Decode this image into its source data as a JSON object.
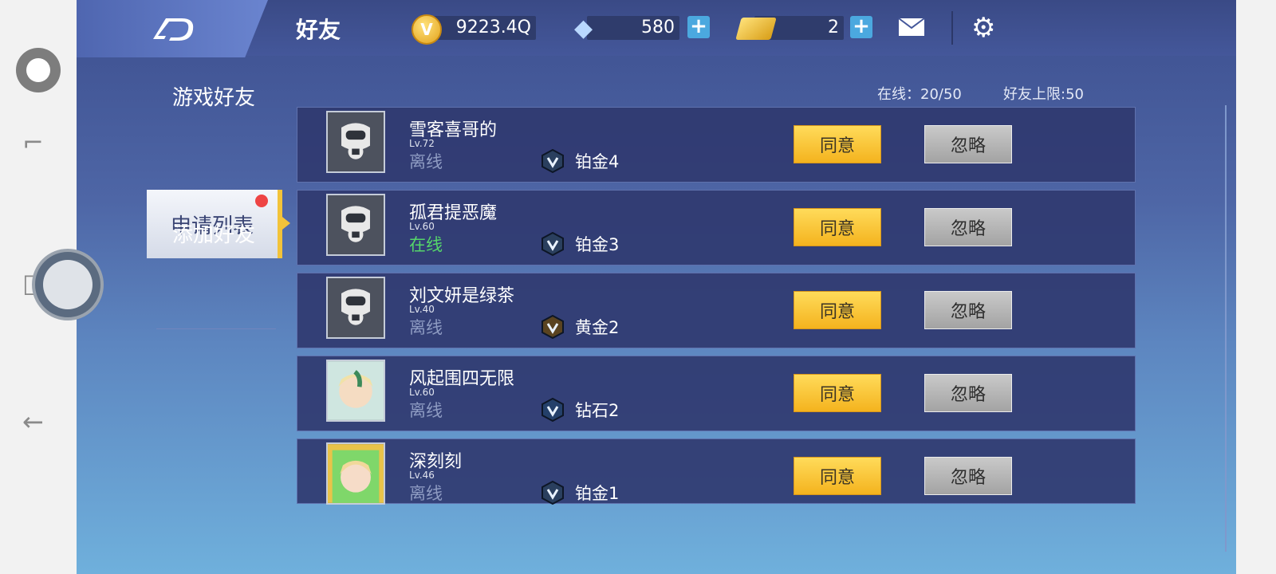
{
  "system": {
    "icons": [
      "circle-icon",
      "split-screen-icon",
      "recents-icon",
      "back-arrow-icon"
    ]
  },
  "header": {
    "title": "好友",
    "coins": "9223.4Q",
    "coin_glyph": "V",
    "diamonds": "580",
    "tickets": "2",
    "plus": "+"
  },
  "menu": {
    "items": [
      {
        "label": "游戏好友"
      },
      {
        "label": "申请列表"
      },
      {
        "label": "添加好友"
      }
    ]
  },
  "stats": {
    "online": "在线：20/50",
    "limit": "好友上限:50"
  },
  "requests": [
    {
      "name": "雪客喜哥的",
      "level": "Lv.72",
      "status": "离线",
      "rank": "铂金4",
      "agree": "同意",
      "ignore": "忽略"
    },
    {
      "name": "孤君提恶魔",
      "level": "Lv.60",
      "status": "在线",
      "rank": "铂金3",
      "agree": "同意",
      "ignore": "忽略"
    },
    {
      "name": "刘文妍是绿茶",
      "level": "Lv.40",
      "status": "离线",
      "rank": "黄金2",
      "agree": "同意",
      "ignore": "忽略"
    },
    {
      "name": "风起围四无限",
      "level": "Lv.60",
      "status": "离线",
      "rank": "钻石2",
      "agree": "同意",
      "ignore": "忽略"
    },
    {
      "name": "深刻刻",
      "level": "Lv.46",
      "status": "离线",
      "rank": "铂金1",
      "agree": "同意",
      "ignore": "忽略"
    }
  ],
  "colors": {
    "agree": "#f6bd2a",
    "ignore": "#b5b5b5",
    "online": "#55d56a",
    "offline": "#8e9bc2"
  }
}
